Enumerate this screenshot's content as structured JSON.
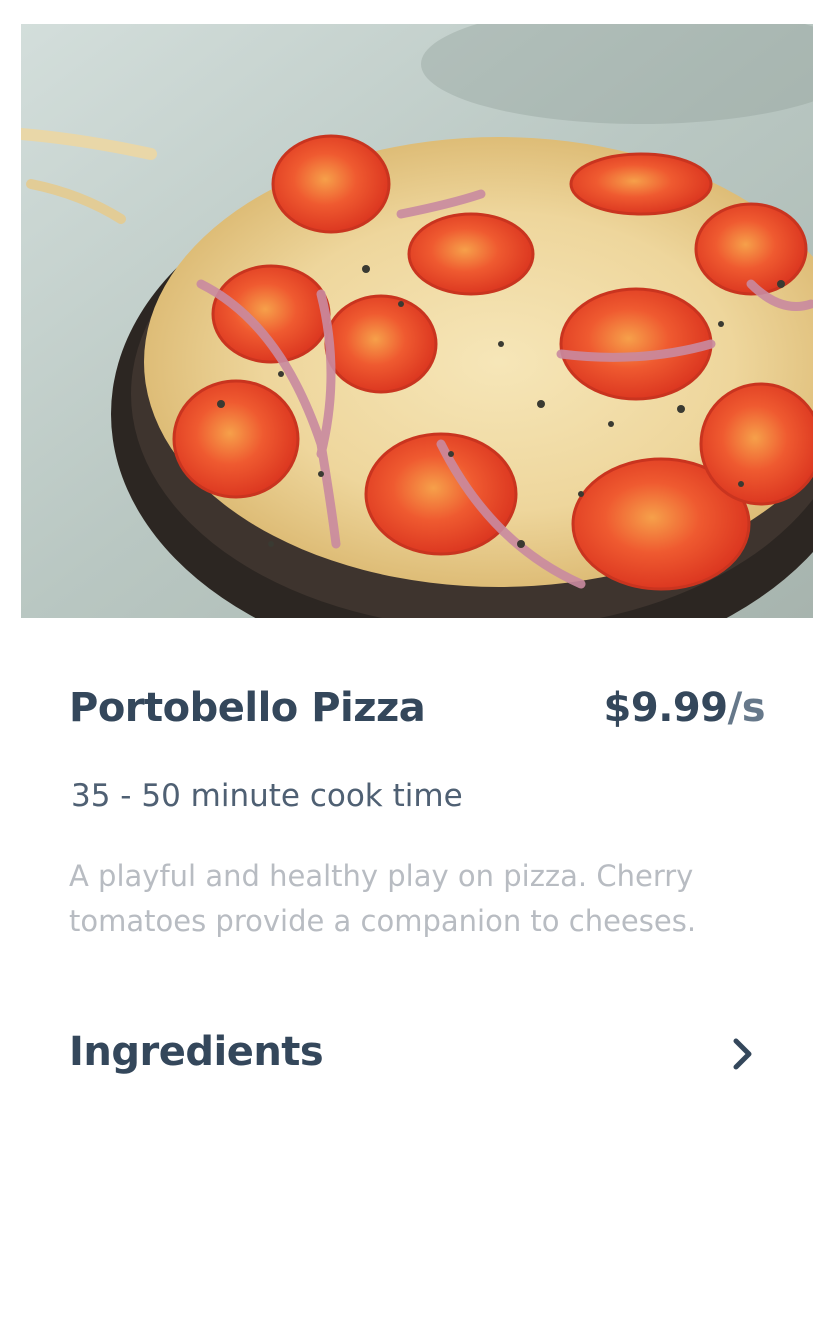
{
  "item": {
    "title": "Portobello Pizza",
    "price": "$9.99",
    "price_unit": "/s",
    "cook_time": "35 - 50 minute cook time",
    "description": "A playful and healthy play on pizza. Cherry tomatoes provide a companion to cheeses."
  },
  "ingredients": {
    "label": "Ingredients",
    "icon": "chevron-right-icon"
  },
  "colors": {
    "heading": "#34475b",
    "price_unit": "#66788a",
    "subtext": "#4f6073",
    "muted": "#b8bcc2"
  }
}
